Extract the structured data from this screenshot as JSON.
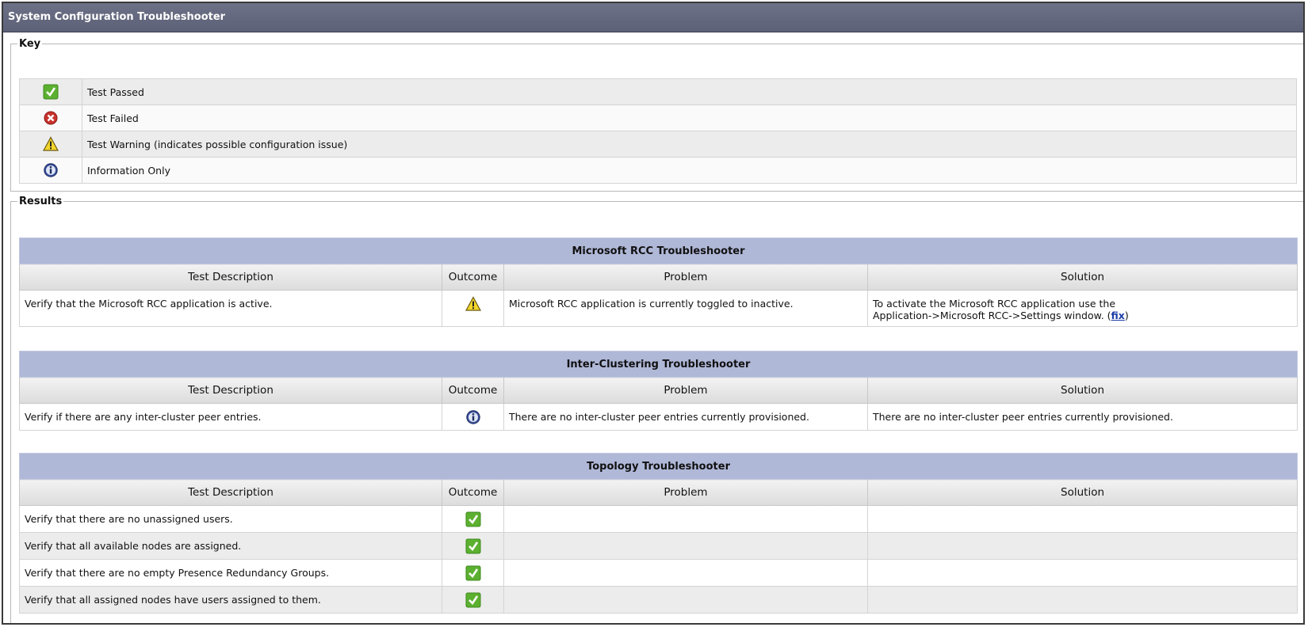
{
  "window": {
    "title": "System Configuration Troubleshooter"
  },
  "key": {
    "legend": "Key",
    "items": [
      {
        "icon": "check-icon",
        "label": "Test Passed"
      },
      {
        "icon": "error-icon",
        "label": "Test Failed"
      },
      {
        "icon": "warning-icon",
        "label": "Test Warning (indicates possible configuration issue)"
      },
      {
        "icon": "info-icon",
        "label": "Information Only"
      }
    ]
  },
  "results": {
    "legend": "Results",
    "columns": [
      "Test Description",
      "Outcome",
      "Problem",
      "Solution"
    ],
    "sections": [
      {
        "title": "Microsoft RCC Troubleshooter",
        "rows": [
          {
            "description": "Verify that the Microsoft RCC application is active.",
            "outcome": "warning-icon",
            "problem": "Microsoft RCC application is currently toggled to inactive.",
            "solution_line1": "To activate the Microsoft RCC application use the",
            "solution_line2": "Application->Microsoft RCC->Settings window. (",
            "solution_link": "fix",
            "solution_end": ")"
          }
        ]
      },
      {
        "title": "Inter-Clustering Troubleshooter",
        "rows": [
          {
            "description": "Verify if there are any inter-cluster peer entries.",
            "outcome": "info-icon",
            "problem": "There are no inter-cluster peer entries currently provisioned.",
            "solution": "There are no inter-cluster peer entries currently provisioned."
          }
        ]
      },
      {
        "title": "Topology Troubleshooter",
        "rows": [
          {
            "description": "Verify that there are no unassigned users.",
            "outcome": "check-icon",
            "problem": "",
            "solution": ""
          },
          {
            "description": "Verify that all available nodes are assigned.",
            "outcome": "check-icon",
            "problem": "",
            "solution": ""
          },
          {
            "description": "Verify that there are no empty Presence Redundancy Groups.",
            "outcome": "check-icon",
            "problem": "",
            "solution": ""
          },
          {
            "description": "Verify that all assigned nodes have users assigned to them.",
            "outcome": "check-icon",
            "problem": "",
            "solution": ""
          }
        ]
      }
    ]
  }
}
